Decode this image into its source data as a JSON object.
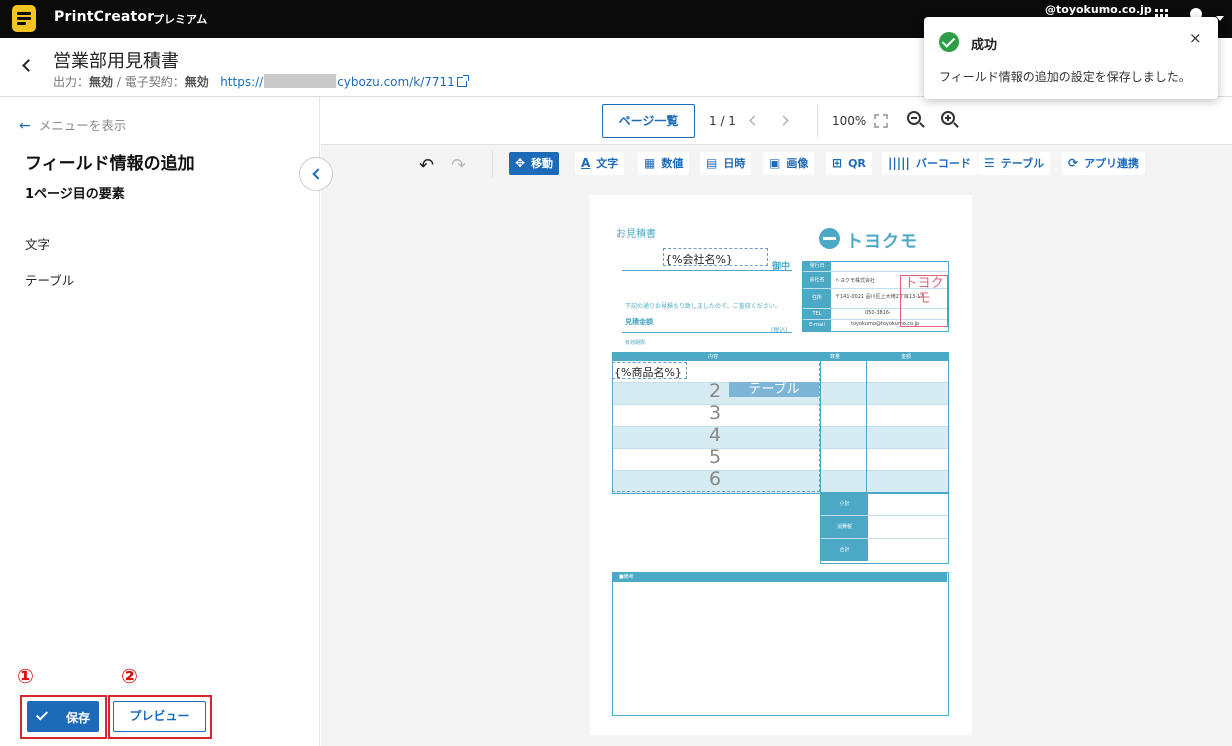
{
  "app": {
    "brand": "PrintCreator",
    "plan": "プレミアム",
    "account_domain": "@toyokumo.co.jp"
  },
  "header": {
    "title": "営業部用見積書",
    "meta_prefix": "出力：",
    "meta_output": "無効",
    "meta_sep": " / 電子契約：",
    "meta_contract": "無効",
    "link_start": "https://",
    "link_end": "cybozu.com/k/7711"
  },
  "toast": {
    "title": "成功",
    "message": "フィールド情報の追加の設定を保存しました。",
    "close_label": "×"
  },
  "left_panel": {
    "menu_link": "メニューを表示",
    "title": "フィールド情報の追加",
    "subtitle": "1ページ目の要素",
    "items": [
      "文字",
      "テーブル"
    ],
    "mark1": "①",
    "mark2": "②",
    "save_label": "保存",
    "preview_label": "プレビュー"
  },
  "pagebar": {
    "page_list_label": "ページ一覧",
    "page_count": "1 / 1",
    "zoom": "100%"
  },
  "toolbar": {
    "tools": [
      {
        "label": "移動",
        "icon": "move-icon",
        "active": true
      },
      {
        "label": "文字",
        "icon": "text-icon"
      },
      {
        "label": "数値",
        "icon": "number-icon"
      },
      {
        "label": "日時",
        "icon": "calendar-icon"
      },
      {
        "label": "画像",
        "icon": "image-icon"
      },
      {
        "label": "QR",
        "icon": "qr-icon"
      },
      {
        "label": "バーコード",
        "icon": "barcode-icon"
      },
      {
        "label": "テーブル",
        "icon": "table-icon"
      },
      {
        "label": "アプリ連携",
        "icon": "sync-icon"
      }
    ]
  },
  "document": {
    "quote_title": "お見積書",
    "logo_text": "トヨクモ",
    "company_field": "{%会社名%}",
    "honorific": "御中",
    "intro": "下記の通りお見積もり致しましたので、ご査収ください。",
    "amount_label": "見積金額",
    "tax_note": "(税込)",
    "expiry_label": "有効期限:",
    "info_rows": [
      {
        "key": "発行日",
        "value": ""
      },
      {
        "key": "会社名",
        "value": "トヨクモ株式会社"
      },
      {
        "key": "住所",
        "value": "〒141-0021 品川区上大崎2丁目13-17"
      },
      {
        "key": "TEL",
        "value": "050-3816-"
      },
      {
        "key": "E-mail",
        "value": "toyokumo@toyokumo.co.jp"
      }
    ],
    "stamp_text": "トヨクモ",
    "items_headers": [
      "内容",
      "数量",
      "金額"
    ],
    "product_field": "{%商品名%}",
    "table_tag": "テーブル",
    "row_numbers": [
      "2",
      "3",
      "4",
      "5",
      "6"
    ],
    "summary": [
      "小計",
      "消費税",
      "合計"
    ],
    "notes_label": "■備考"
  }
}
